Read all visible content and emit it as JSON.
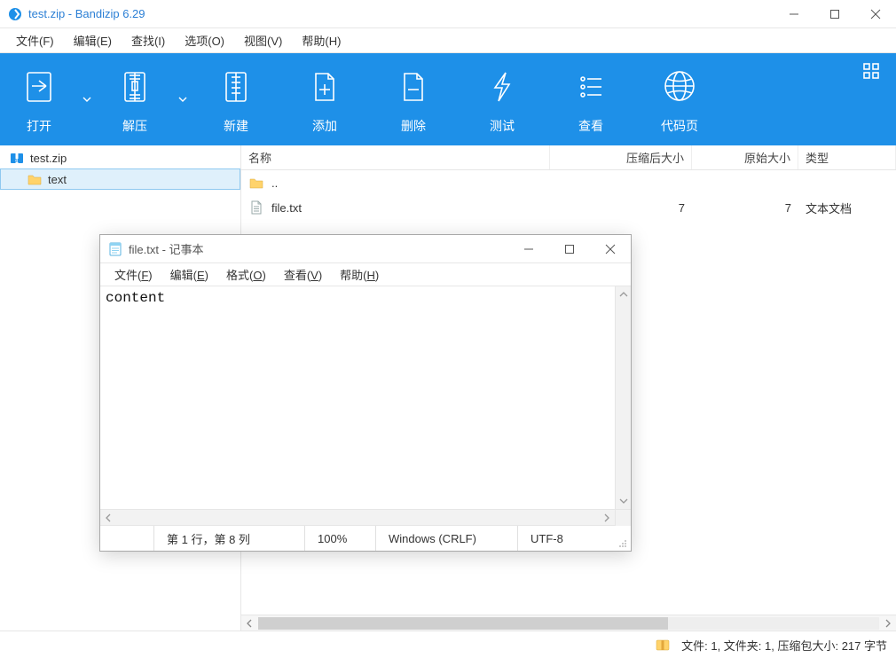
{
  "window": {
    "title": "test.zip - Bandizip 6.29"
  },
  "menu": {
    "file": "文件(F)",
    "edit": "编辑(E)",
    "find": "查找(I)",
    "options": "选项(O)",
    "view": "视图(V)",
    "help": "帮助(H)"
  },
  "toolbar": {
    "open": "打开",
    "extract": "解压",
    "new": "新建",
    "add": "添加",
    "delete": "删除",
    "test": "测试",
    "view": "查看",
    "codepage": "代码页"
  },
  "tree": {
    "root": "test.zip",
    "child": "text"
  },
  "list": {
    "headers": {
      "name": "名称",
      "compressed": "压缩后大小",
      "original": "原始大小",
      "type": "类型"
    },
    "rows": [
      {
        "name": "..",
        "compressed": "",
        "original": "",
        "type": "",
        "kind": "up"
      },
      {
        "name": "file.txt",
        "compressed": "7",
        "original": "7",
        "type": "文本文档",
        "kind": "file"
      }
    ]
  },
  "statusbar": {
    "text": "文件: 1, 文件夹: 1, 压缩包大小: 217 字节"
  },
  "notepad": {
    "title": "file.txt - 记事本",
    "menu": {
      "file": "文件(F)",
      "edit": "编辑(E)",
      "format": "格式(O)",
      "view": "查看(V)",
      "help": "帮助(H)"
    },
    "content": "content",
    "status": {
      "position": "第 1 行，第 8 列",
      "zoom": "100%",
      "eol": "Windows (CRLF)",
      "encoding": "UTF-8"
    }
  }
}
